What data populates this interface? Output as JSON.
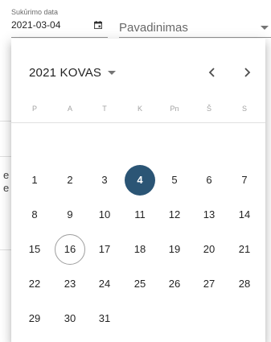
{
  "date_field": {
    "label": "Sukūrimo data",
    "value": "2021-03-04",
    "icon": "calendar-icon"
  },
  "title_field": {
    "placeholder": "Pavadinimas",
    "icon": "dropdown-arrow-icon"
  },
  "background_fragments": [
    "e",
    "e"
  ],
  "calendar": {
    "month_label": "2021 KOVAS",
    "prev_icon": "chevron-left-icon",
    "next_icon": "chevron-right-icon",
    "weekdays": [
      "P",
      "A",
      "T",
      "K",
      "Pn",
      "Š",
      "S"
    ],
    "selected_day": "4",
    "today_day": "16",
    "selected_color": "#2b5575",
    "weeks": [
      [
        "1",
        "2",
        "3",
        "4",
        "5",
        "6",
        "7"
      ],
      [
        "8",
        "9",
        "10",
        "11",
        "12",
        "13",
        "14"
      ],
      [
        "15",
        "16",
        "17",
        "18",
        "19",
        "20",
        "21"
      ],
      [
        "22",
        "23",
        "24",
        "25",
        "26",
        "27",
        "28"
      ],
      [
        "29",
        "30",
        "31"
      ]
    ]
  }
}
